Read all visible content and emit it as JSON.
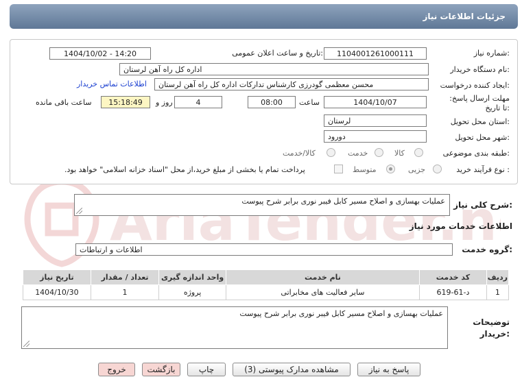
{
  "header": {
    "title": "جزئیات اطلاعات نیاز"
  },
  "form": {
    "need_number_label": "شماره نیاز:",
    "need_number": "1104001261000111",
    "announce_label": "تاریخ و ساعت اعلان عمومی:",
    "announce_value": "1404/10/02 - 14:20",
    "buyer_org_label": "نام دستگاه خریدار:",
    "buyer_org": "اداره کل راه آهن لرستان",
    "creator_label": "ایجاد کننده درخواست:",
    "creator": "محسن معظمی گودرزی کارشناس تدارکات اداره کل راه آهن لرستان",
    "contact_link": "اطلاعات تماس خریدار",
    "deadline_label": "مهلت ارسال پاسخ: تا تاریخ:",
    "deadline_date": "1404/10/07",
    "time_label": "ساعت",
    "deadline_time": "08:00",
    "days_value": "4",
    "days_label": "روز و",
    "remaining_time": "15:18:49",
    "remaining_label": "ساعت باقی مانده",
    "province_label": "استان محل تحویل:",
    "province": "لرستان",
    "city_label": "شهر محل تحویل:",
    "city": "دورود",
    "category_label": "طبقه بندی موضوعی:",
    "category_options": [
      "کالا",
      "خدمت",
      "کالا/خدمت"
    ],
    "process_label": "نوع فرآیند خرید :",
    "process_options": [
      "جزیی",
      "متوسط"
    ],
    "payment_note": "پرداخت تمام یا بخشی از مبلغ خرید،از محل \"اسناد خزانه اسلامی\" خواهد بود."
  },
  "summary": {
    "label": "شرح کلی نیاز:",
    "value": "عملیات بهسازی و اصلاح مسیر کابل فیبر نوری برابر شرح پیوست"
  },
  "services": {
    "title": "اطلاعات خدمات مورد نیاز",
    "group_label": "گروه خدمت:",
    "group_value": "اطلاعات و ارتباطات",
    "columns": [
      "ردیف",
      "کد خدمت",
      "نام خدمت",
      "واحد اندازه گیری",
      "تعداد / مقدار",
      "تاریخ نیاز"
    ],
    "rows": [
      {
        "row": "1",
        "code": "د-61-619",
        "name": "سایر فعالیت های مخابراتی",
        "unit": "پروژه",
        "qty": "1",
        "date": "1404/10/30"
      }
    ]
  },
  "notes": {
    "label": "توضیحات خریدار:",
    "value": "عملیات بهسازی و اصلاح مسیر کابل فیبر نوری برابر شرح پیوست"
  },
  "buttons": {
    "reply": "پاسخ به نیاز",
    "attachments": "مشاهده مدارک پیوستی (3)",
    "print": "چاپ",
    "back": "بازگشت",
    "exit": "خروج"
  },
  "watermark": {
    "text": "AriaTender.neT"
  },
  "colors": {
    "title_bar": "#6f87a5",
    "link": "#1a3fd0",
    "remaining_bg": "#fdf6c3",
    "watermark": "#f3d7d7"
  }
}
